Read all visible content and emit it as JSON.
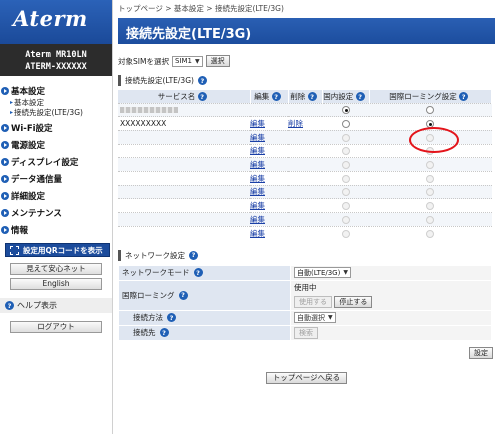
{
  "sidebar": {
    "logo": "Aterm",
    "model_line1": "Aterm   MR10LN",
    "model_line2": "ATERM-XXXXXX",
    "menu": [
      {
        "label": "基本設定",
        "subs": [
          "基本設定",
          "接続先設定(LTE/3G)"
        ]
      },
      {
        "label": "Wi-Fi設定"
      },
      {
        "label": "電源設定"
      },
      {
        "label": "ディスプレイ設定"
      },
      {
        "label": "データ通信量"
      },
      {
        "label": "詳細設定"
      },
      {
        "label": "メンテナンス"
      },
      {
        "label": "情報"
      }
    ],
    "qr_button": "設定用QRコードを表示",
    "mieru_button": "見えて安心ネット",
    "english_button": "English",
    "help_label": "ヘルプ表示",
    "logout_button": "ログアウト"
  },
  "main": {
    "breadcrumb": "トップページ > 基本設定 > 接続先設定(LTE/3G)",
    "title": "接続先設定(LTE/3G)",
    "sim_label": "対象SIMを選択",
    "sim_value": "SIM1",
    "select_button": "選択",
    "apn_section": "接続先設定(LTE/3G)",
    "columns": [
      "サービス名",
      "編集",
      "削除",
      "国内設定",
      "国際ローミング設定"
    ],
    "rows": [
      {
        "name": "",
        "edit": "",
        "del": "",
        "domestic": "on",
        "roaming": "off"
      },
      {
        "name": "XXXXXXXXX",
        "edit": "編集",
        "del": "削除",
        "domestic": "off",
        "roaming": "on"
      },
      {
        "name": "",
        "edit": "編集",
        "del": "",
        "domestic": "dim",
        "roaming": "dim"
      },
      {
        "name": "",
        "edit": "編集",
        "del": "",
        "domestic": "dim",
        "roaming": "dim"
      },
      {
        "name": "",
        "edit": "編集",
        "del": "",
        "domestic": "dim",
        "roaming": "dim"
      },
      {
        "name": "",
        "edit": "編集",
        "del": "",
        "domestic": "dim",
        "roaming": "dim"
      },
      {
        "name": "",
        "edit": "編集",
        "del": "",
        "domestic": "dim",
        "roaming": "dim"
      },
      {
        "name": "",
        "edit": "編集",
        "del": "",
        "domestic": "dim",
        "roaming": "dim"
      },
      {
        "name": "",
        "edit": "編集",
        "del": "",
        "domestic": "dim",
        "roaming": "dim"
      },
      {
        "name": "",
        "edit": "編集",
        "del": "",
        "domestic": "dim",
        "roaming": "dim"
      }
    ],
    "network_section": "ネットワーク設定",
    "network_mode_label": "ネットワークモード",
    "network_mode_value": "自動(LTE/3G)",
    "roaming_label": "国際ローミング",
    "roaming_status": "使用中",
    "roaming_use_button": "使用する",
    "roaming_stop_button": "停止する",
    "method_label": "接続方法",
    "method_value": "自動選択",
    "dest_label": "接続先",
    "search_button": "検索",
    "set_button": "設定",
    "top_button": "トップページへ戻る"
  },
  "colors": {
    "brand": "#1c4d9e",
    "highlight_ring": "#e3141b"
  }
}
